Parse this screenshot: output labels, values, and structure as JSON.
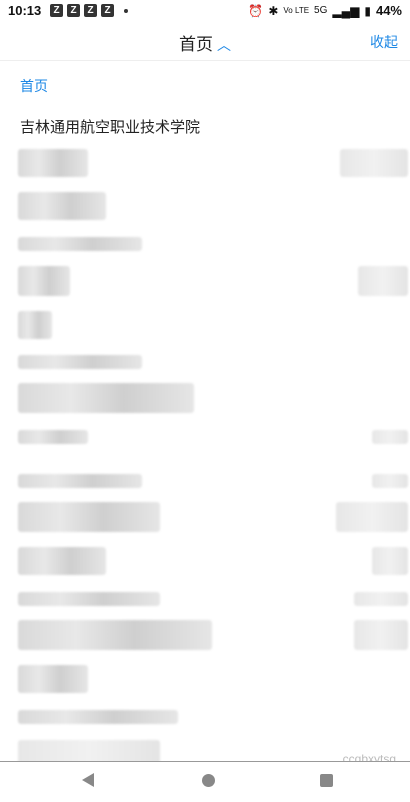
{
  "status_bar": {
    "time": "10:13",
    "notif_glyph": "Z",
    "network": "5G",
    "volte": "Vo LTE",
    "battery": "44%"
  },
  "header": {
    "title": "首页",
    "collapse": "收起"
  },
  "breadcrumb": "首页",
  "school": "吉林通用航空职业技术学院",
  "watermark": "ccqbxytsg",
  "colors": {
    "accent": "#1e88e5",
    "text": "#222222"
  }
}
